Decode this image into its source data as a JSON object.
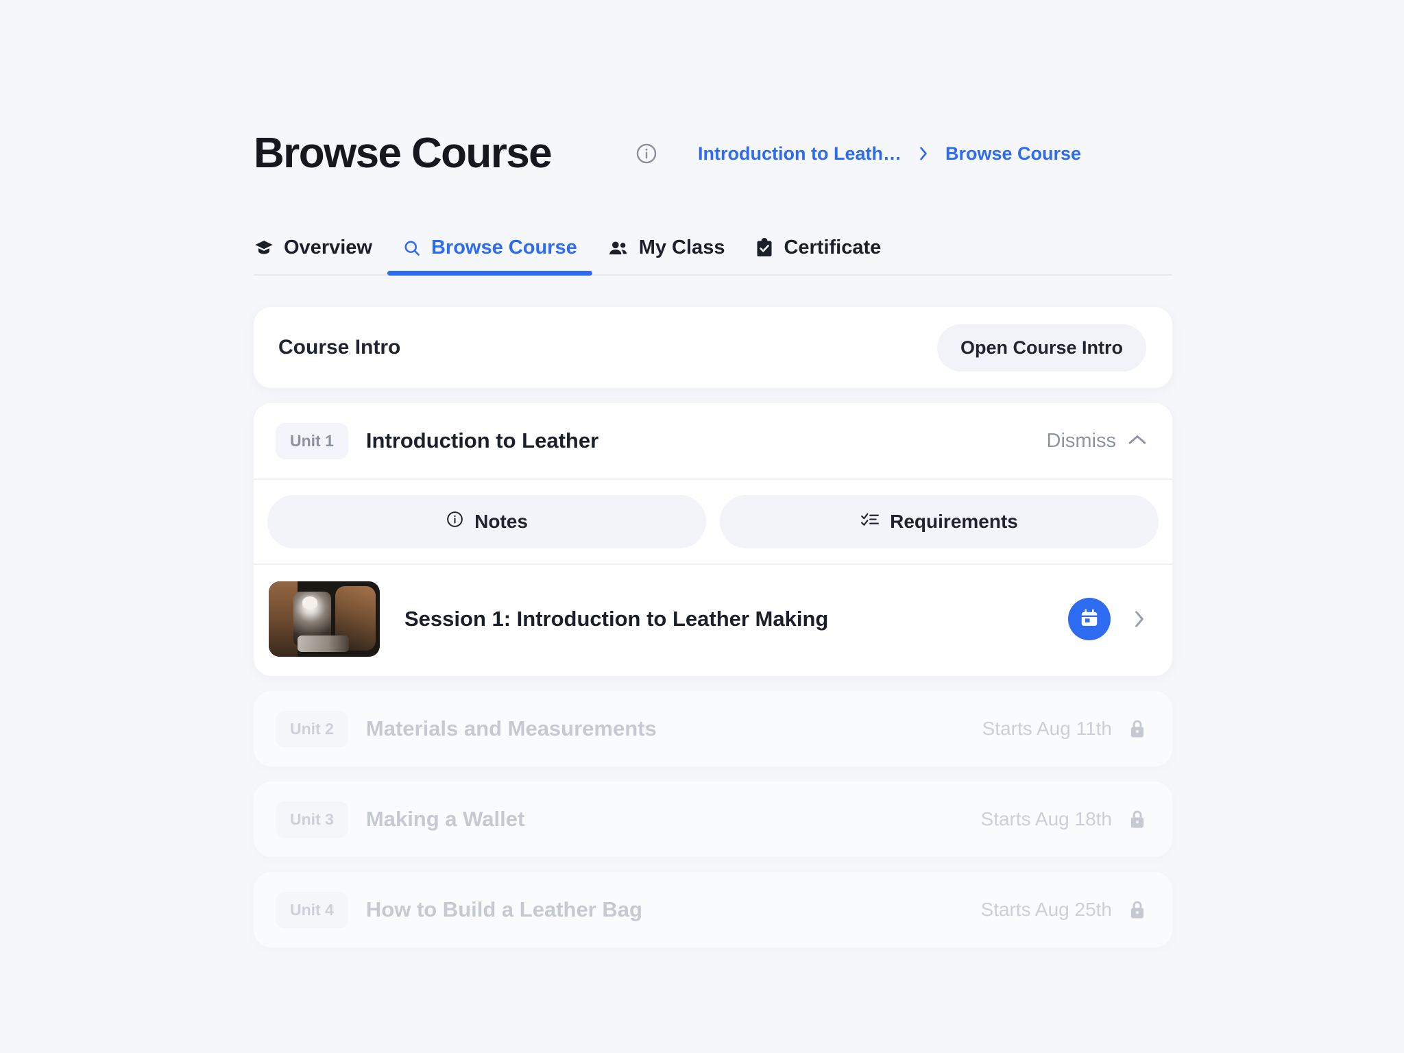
{
  "header": {
    "title": "Browse Course",
    "info_icon": "info-circle-icon",
    "breadcrumb": {
      "parent": "Introduction to Leath…",
      "separator": "›",
      "current": "Browse Course"
    }
  },
  "tabs": [
    {
      "label": "Overview",
      "icon": "graduation-cap-icon",
      "active": false
    },
    {
      "label": "Browse Course",
      "icon": "search-icon",
      "active": true
    },
    {
      "label": "My Class",
      "icon": "people-icon",
      "active": false
    },
    {
      "label": "Certificate",
      "icon": "clipboard-check-icon",
      "active": false
    }
  ],
  "course_intro": {
    "label": "Course Intro",
    "button_label": "Open Course Intro"
  },
  "active_unit": {
    "badge": "Unit 1",
    "title": "Introduction to Leather",
    "dismiss_label": "Dismiss",
    "collapse_icon": "chevron-up-icon",
    "actions": [
      {
        "label": "Notes",
        "icon": "info-circle-icon"
      },
      {
        "label": "Requirements",
        "icon": "checklist-icon"
      }
    ],
    "session": {
      "title": "Session 1: Introduction to Leather Making",
      "thumbnail": "leather-workshop-thumbnail",
      "calendar_icon": "calendar-icon",
      "chevron_icon": "chevron-right-icon"
    }
  },
  "locked_units": [
    {
      "badge": "Unit 2",
      "title": "Materials and Measurements",
      "starts": "Starts Aug 11th",
      "lock_icon": "lock-icon"
    },
    {
      "badge": "Unit 3",
      "title": "Making a Wallet",
      "starts": "Starts Aug 18th",
      "lock_icon": "lock-icon"
    },
    {
      "badge": "Unit 4",
      "title": "How to Build a Leather Bag",
      "starts": "Starts Aug 25th",
      "lock_icon": "lock-icon"
    }
  ],
  "colors": {
    "accent": "#2d6bf0",
    "page_background": "#f6f7fb",
    "card_background": "#ffffff",
    "muted_text": "#9aa0ad"
  }
}
